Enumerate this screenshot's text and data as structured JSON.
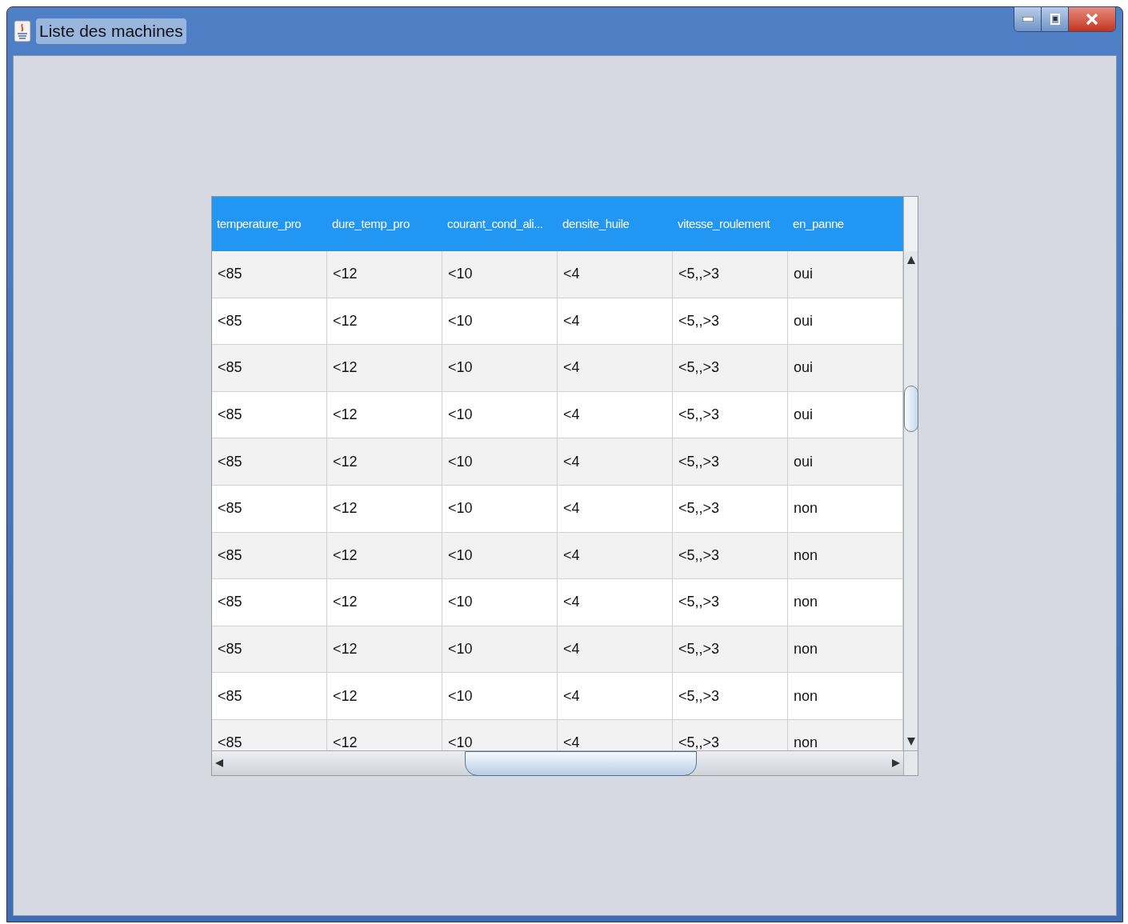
{
  "window": {
    "title": "Liste des machines"
  },
  "table": {
    "columns": [
      "temperature_pro",
      "dure_temp_pro",
      "courant_cond_ali...",
      "densite_huile",
      "vitesse_roulement",
      "en_panne"
    ],
    "rows": [
      [
        "<85",
        "<12",
        "<10",
        "<4",
        "<5,,>3",
        "oui"
      ],
      [
        "<85",
        "<12",
        "<10",
        "<4",
        "<5,,>3",
        "oui"
      ],
      [
        "<85",
        "<12",
        "<10",
        "<4",
        "<5,,>3",
        "oui"
      ],
      [
        "<85",
        "<12",
        "<10",
        "<4",
        "<5,,>3",
        "oui"
      ],
      [
        "<85",
        "<12",
        "<10",
        "<4",
        "<5,,>3",
        "oui"
      ],
      [
        "<85",
        "<12",
        "<10",
        "<4",
        "<5,,>3",
        "non"
      ],
      [
        "<85",
        "<12",
        "<10",
        "<4",
        "<5,,>3",
        "non"
      ],
      [
        "<85",
        "<12",
        "<10",
        "<4",
        "<5,,>3",
        "non"
      ],
      [
        "<85",
        "<12",
        "<10",
        "<4",
        "<5,,>3",
        "non"
      ],
      [
        "<85",
        "<12",
        "<10",
        "<4",
        "<5,,>3",
        "non"
      ],
      [
        "<85",
        "<12",
        "<10",
        "<4",
        "<5,,>3",
        "non"
      ]
    ]
  }
}
